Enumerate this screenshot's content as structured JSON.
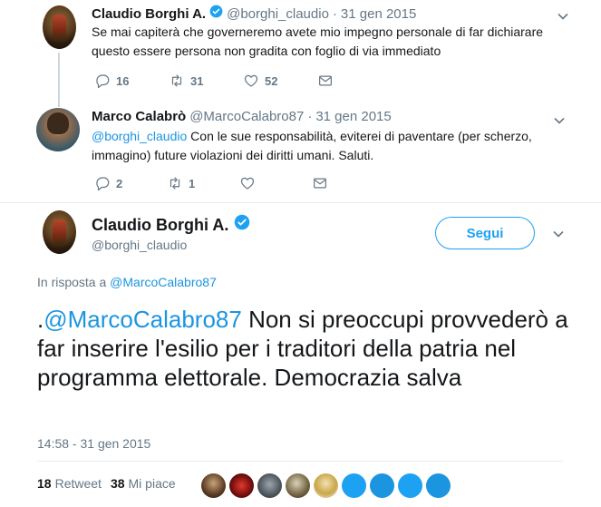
{
  "tweet1": {
    "name": "Claudio Borghi A.",
    "handle": "@borghi_claudio",
    "dot": "·",
    "time": "31 gen 2015",
    "text": "Se mai capiterà che governeremo avete mio impegno personale di far dichiarare questo essere persona non gradita con foglio di via immediato",
    "replies": "16",
    "retweets": "31",
    "likes": "52"
  },
  "tweet2": {
    "name": "Marco Calabrò",
    "handle": "@MarcoCalabro87",
    "dot": "·",
    "time": "31 gen 2015",
    "mention": "@borghi_claudio",
    "text": " Con le sue responsabilità, eviterei di paventare (per scherzo, immagino) future violazioni dei diritti umani. Saluti.",
    "replies": "2",
    "retweets": "1"
  },
  "main_tweet": {
    "name": "Claudio Borghi A.",
    "handle": "@borghi_claudio",
    "follow_label": "Segui",
    "reply_prefix": "In risposta a ",
    "reply_handle": "@MarcoCalabro87",
    "text_prefix": ".",
    "mention": "@MarcoCalabro87",
    "text": " Non si preoccupi provvederò a far inserire l'esilio per i traditori della patria nel programma elettorale. Democrazia salva",
    "timestamp": "14:58 - 31 gen 2015",
    "retweet_count": "18",
    "retweet_label": "Retweet",
    "like_count": "38",
    "like_label": "Mi piace"
  },
  "colors": {
    "link": "#1b95e0",
    "accent": "#1da1f2",
    "muted": "#657786",
    "text": "#14171a"
  },
  "icons": [
    "verified-badge-icon",
    "reply-icon",
    "retweet-icon",
    "like-icon",
    "dm-icon",
    "chevron-down-icon"
  ]
}
